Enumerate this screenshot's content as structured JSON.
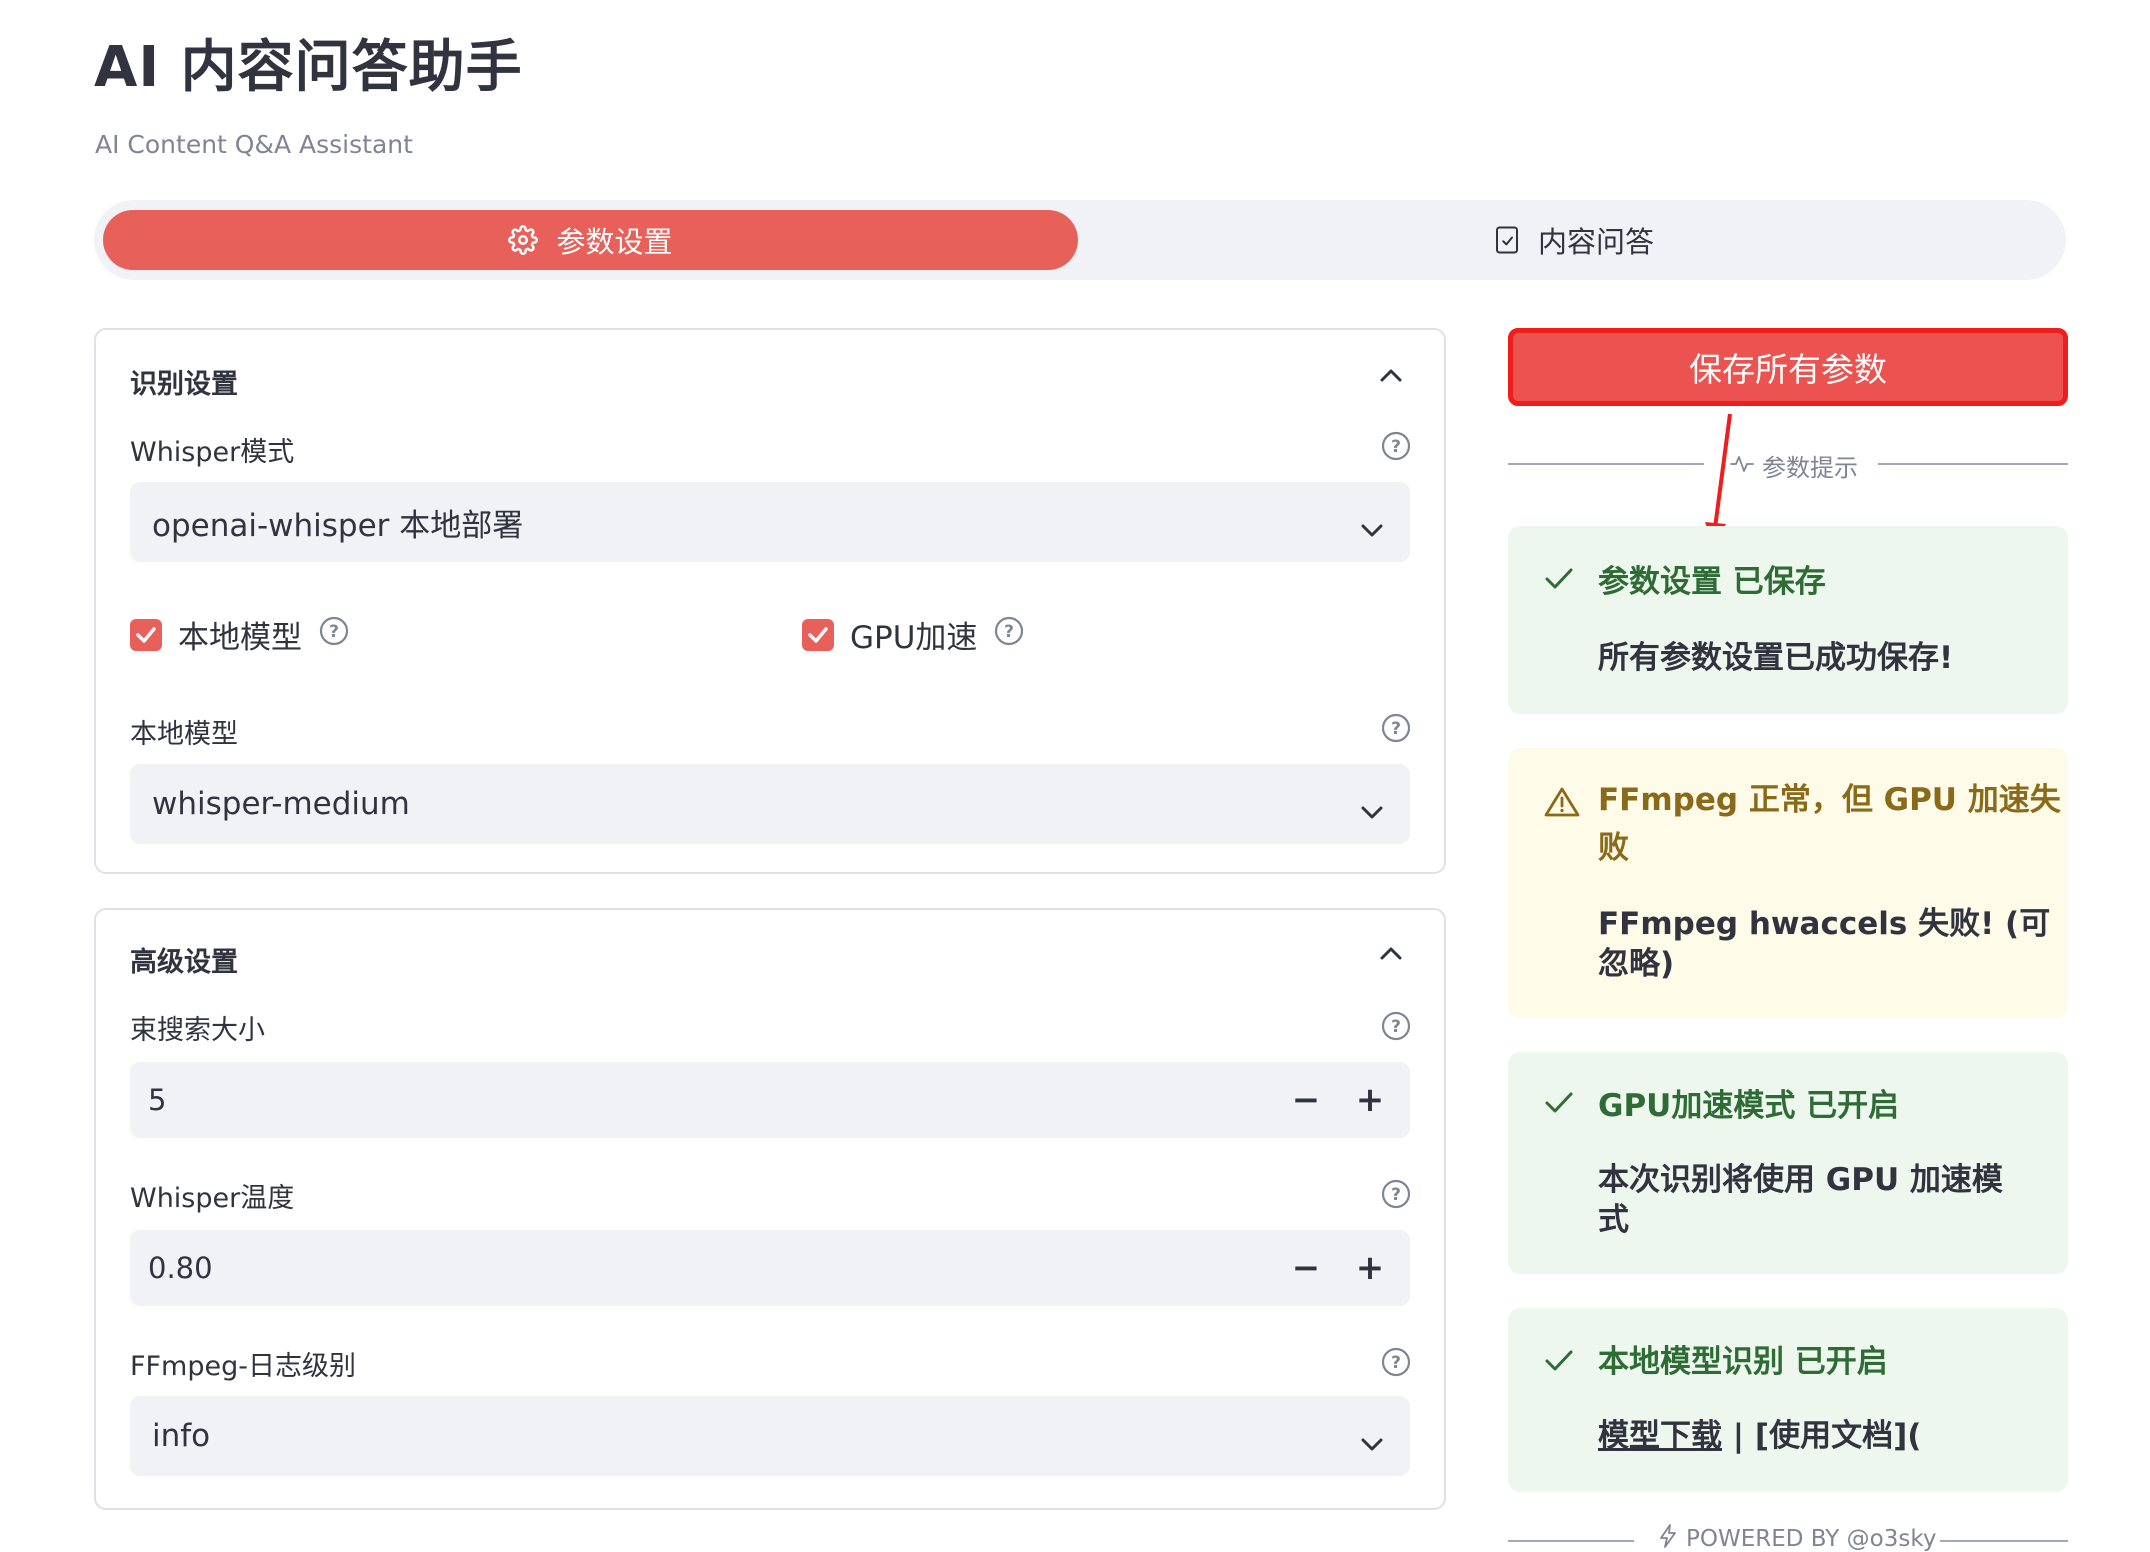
{
  "header": {
    "title": "AI 内容问答助手",
    "subtitle": "AI Content Q&A Assistant"
  },
  "tabs": [
    {
      "label": "参数设置",
      "icon": "gear-icon",
      "active": true
    },
    {
      "label": "内容问答",
      "icon": "document-check-icon",
      "active": false
    }
  ],
  "recognition": {
    "title": "识别设置",
    "whisper_mode_label": "Whisper模式",
    "whisper_mode_value": "openai-whisper 本地部署",
    "local_model_checkbox": {
      "label": "本地模型",
      "checked": true
    },
    "gpu_checkbox": {
      "label": "GPU加速",
      "checked": true
    },
    "local_model_label": "本地模型",
    "local_model_value": "whisper-medium"
  },
  "advanced": {
    "title": "高级设置",
    "beam_label": "束搜索大小",
    "beam_value": "5",
    "temperature_label": "Whisper温度",
    "temperature_value": "0.80",
    "ffmpeg_log_label": "FFmpeg-日志级别",
    "ffmpeg_log_value": "info",
    "minus": "−",
    "plus": "+"
  },
  "side": {
    "save_button": "保存所有参数",
    "hint_divider": "参数提示",
    "alerts": [
      {
        "type": "success",
        "title": "参数设置 已保存",
        "body": "所有参数设置已成功保存!"
      },
      {
        "type": "warning",
        "title_line1": "FFmpeg 正常，但 GPU 加速失",
        "title_line2": "败",
        "body_line1": "FFmpeg hwaccels 失败!  (可",
        "body_line2": "忽略)"
      },
      {
        "type": "success",
        "title": "GPU加速模式 已开启",
        "body_line1": "本次识别将使用 GPU 加速模",
        "body_line2": "式"
      },
      {
        "type": "success",
        "title": "本地模型识别 已开启",
        "link_download": "模型下载",
        "body_separator": " | [",
        "link_docs": "使用文档",
        "body_tail": "]("
      }
    ],
    "footer": "POWERED BY @o3sky"
  },
  "colors": {
    "accent": "#e8605a",
    "save_button_bg": "#ec5350",
    "annotation_red": "#f01d1d",
    "success_bg": "#edf7ee",
    "success_text": "#2e6b35",
    "warning_bg": "#fffbe9",
    "warning_text": "#8a6a18"
  }
}
